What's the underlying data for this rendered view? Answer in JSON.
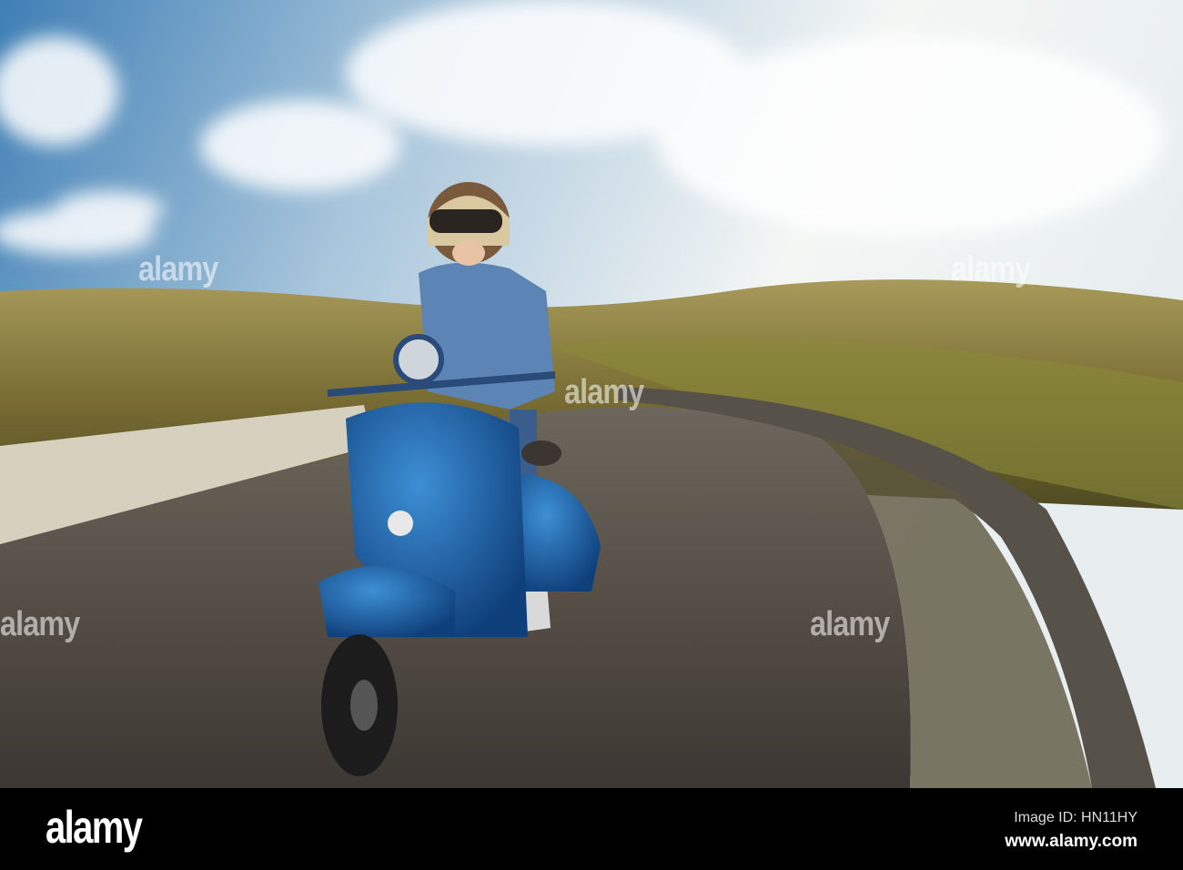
{
  "watermark": {
    "text": "alamy"
  },
  "footer": {
    "logo": "alamy",
    "image_id": "Image ID: HN11HY",
    "url": "www.alamy.com"
  }
}
